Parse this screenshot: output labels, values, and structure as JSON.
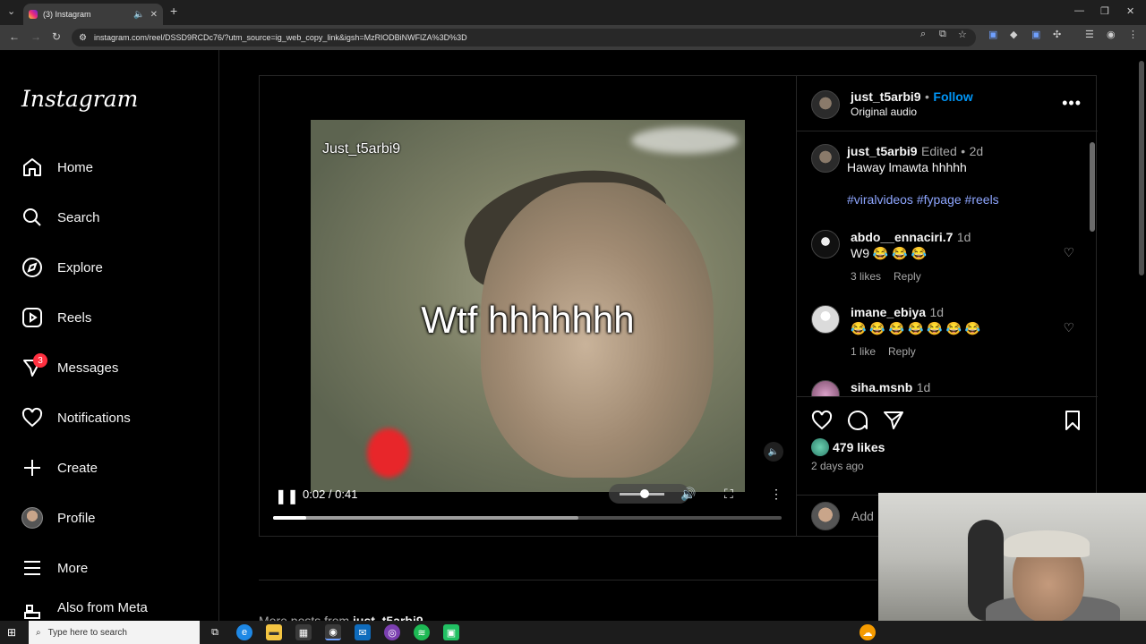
{
  "browser": {
    "tab_title": "(3) Instagram",
    "url": "instagram.com/reel/DSSD9RCDc76/?utm_source=ig_web_copy_link&igsh=MzRlODBiNWFlZA%3D%3D",
    "new_tab_icon": "plus-icon"
  },
  "sidebar": {
    "logo": "Instagram",
    "items": [
      {
        "label": "Home",
        "icon": "home-icon"
      },
      {
        "label": "Search",
        "icon": "search-icon"
      },
      {
        "label": "Explore",
        "icon": "compass-icon"
      },
      {
        "label": "Reels",
        "icon": "reels-icon"
      },
      {
        "label": "Messages",
        "icon": "messenger-icon",
        "badge": "3"
      },
      {
        "label": "Notifications",
        "icon": "heart-icon"
      },
      {
        "label": "Create",
        "icon": "plus-icon"
      },
      {
        "label": "Profile",
        "icon": "avatar"
      },
      {
        "label": "More",
        "icon": "hamburger-icon"
      },
      {
        "label": "Also from Meta",
        "icon": "meta-icon"
      }
    ]
  },
  "video": {
    "watermark": "Just_t5arbi9",
    "caption": "Wtf hhhhhhh",
    "time": "0:02 / 0:41",
    "progress_fraction": 0.065,
    "volume_fraction": 0.55
  },
  "post": {
    "author": "just_t5arbi9",
    "follow_separator": "•",
    "follow_label": "Follow",
    "audio": "Original audio",
    "caption_author": "just_t5arbi9",
    "caption_edited": "Edited",
    "caption_sep": "•",
    "caption_age": "2d",
    "caption_text": "Haway lmawta hhhhh",
    "hashtags": [
      "#viralvideos",
      "#fypage",
      "#reels"
    ],
    "comments": [
      {
        "user": "abdo__ennaciri.7",
        "age": "1d",
        "text": "W9 😂 😂 😂",
        "likes": "3 likes",
        "reply": "Reply"
      },
      {
        "user": "imane_ebiya",
        "age": "1d",
        "text": "😂 😂 😂 😂 😂 😂 😂",
        "likes": "1 like",
        "reply": "Reply"
      },
      {
        "user": "siha.msnb",
        "age": "1d",
        "text": "",
        "likes": "",
        "reply": ""
      }
    ],
    "likes": "479 likes",
    "date": "2 days ago",
    "add_comment_placeholder": "Add"
  },
  "more_posts": {
    "prefix": "More posts from",
    "user": "just_t5arbi9"
  },
  "taskbar": {
    "search_placeholder": "Type here to search"
  },
  "colors": {
    "accent": "#0095f6",
    "badge": "#ff3040",
    "hashtag": "#8ea6ff"
  }
}
